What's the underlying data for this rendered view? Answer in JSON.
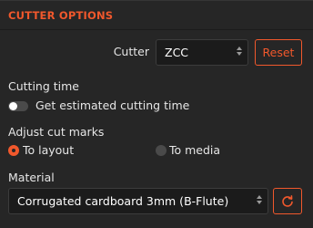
{
  "panel": {
    "title": "CUTTER OPTIONS"
  },
  "cutter": {
    "label": "Cutter",
    "selected": "ZCC",
    "reset_label": "Reset"
  },
  "cutting_time": {
    "heading": "Cutting time",
    "toggle_label": "Get estimated cutting time",
    "enabled": false
  },
  "cut_marks": {
    "heading": "Adjust cut marks",
    "options": [
      {
        "label": "To layout",
        "selected": true
      },
      {
        "label": "To media",
        "selected": false
      }
    ]
  },
  "material": {
    "heading": "Material",
    "selected": "Corrugated cardboard 3mm (B-Flute)"
  },
  "colors": {
    "accent": "#f1582c",
    "background": "#262626",
    "field": "#1b1b1b"
  },
  "icons": {
    "select_arrows": "up-down-chevron-icon",
    "refresh": "refresh-icon",
    "toggle": "toggle-switch"
  }
}
